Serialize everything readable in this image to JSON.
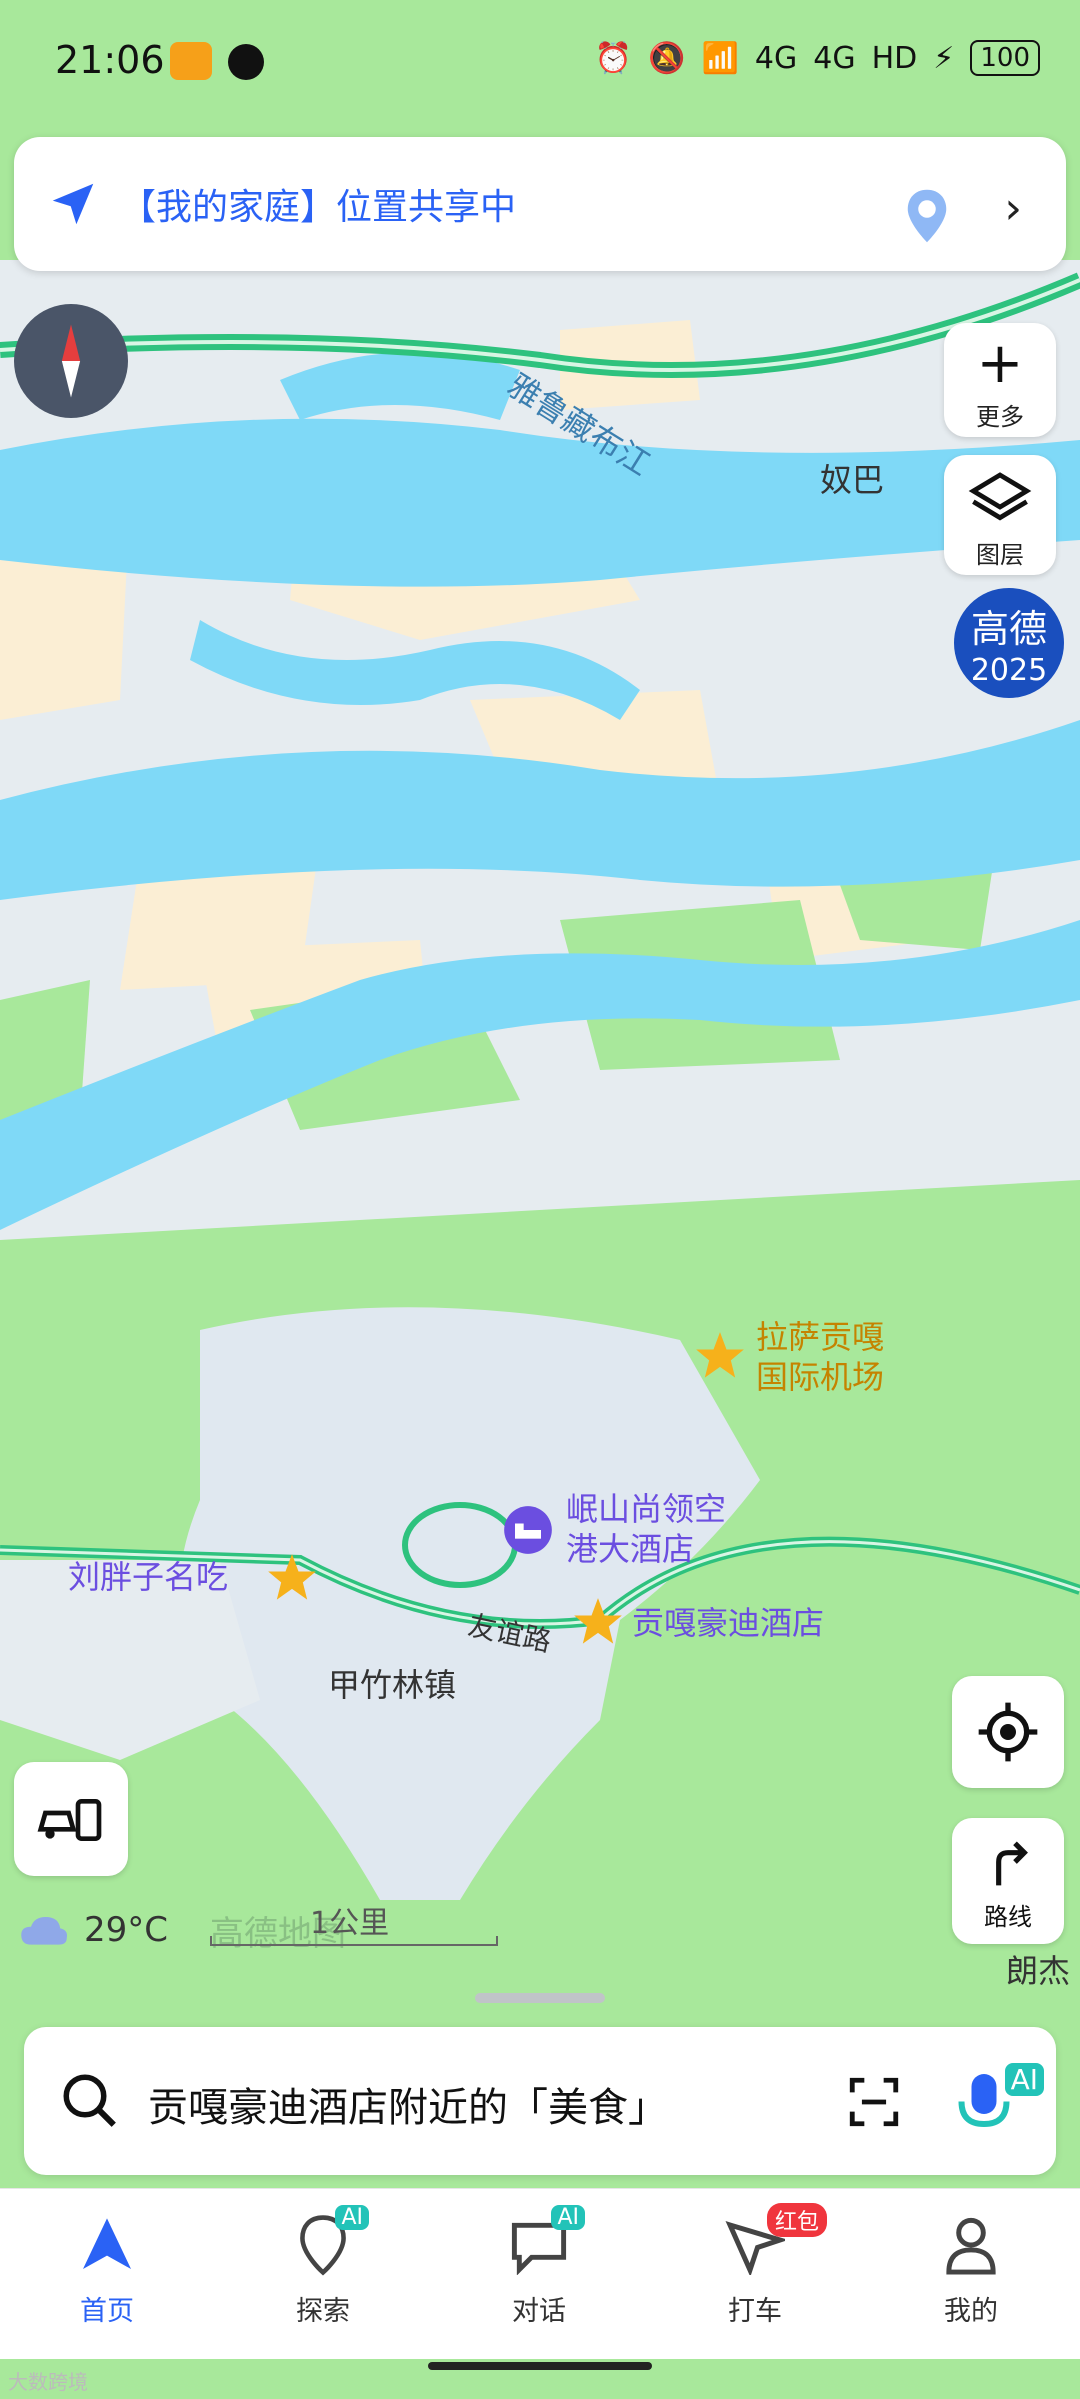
{
  "status_bar": {
    "time": "21:06",
    "network_1": "4G",
    "network_2": "4G",
    "hd_label": "HD",
    "battery": "100"
  },
  "banner": {
    "label": "【我的家庭】位置共享中"
  },
  "side_buttons": {
    "more_label": "更多",
    "layers_label": "图层",
    "brand_line1": "高德",
    "brand_line2": "2025"
  },
  "map": {
    "labels": {
      "river": "雅鲁藏布江",
      "nuba": "奴巴",
      "town": "甲竹林镇",
      "road": "友谊路",
      "langjie": "朗杰"
    },
    "pois": {
      "airport_line1": "拉萨贡嘎",
      "airport_line2": "国际机场",
      "hotel1_line1": "岷山尚领空",
      "hotel1_line2": "港大酒店",
      "hotel2": "贡嘎豪迪酒店",
      "food": "刘胖子名吃"
    },
    "colors": {
      "water": "#7fd9f7",
      "land": "#e6ecf0",
      "green": "#a8e89b",
      "sand": "#fbeed4",
      "road": "#2ec27e",
      "poi_text": "#6b4ee0"
    }
  },
  "weather": {
    "temp": "29°C",
    "icon": "cloud-icon"
  },
  "scale": {
    "value": "1公里",
    "watermark": "高德地图"
  },
  "buttons": {
    "route_label": "路线"
  },
  "search": {
    "text": "贡嘎豪迪酒店附近的「美食」",
    "ai_badge": "AI"
  },
  "tabs": [
    {
      "label": "首页",
      "icon": "navigation-arrow-icon",
      "badge": ""
    },
    {
      "label": "探索",
      "icon": "explore-pin-icon",
      "badge": "AI"
    },
    {
      "label": "对话",
      "icon": "chat-bubble-icon",
      "badge": "AI"
    },
    {
      "label": "打车",
      "icon": "taxi-icon",
      "badge": "红包"
    },
    {
      "label": "我的",
      "icon": "profile-icon",
      "badge": ""
    }
  ],
  "footer_mark": "大数跨境"
}
